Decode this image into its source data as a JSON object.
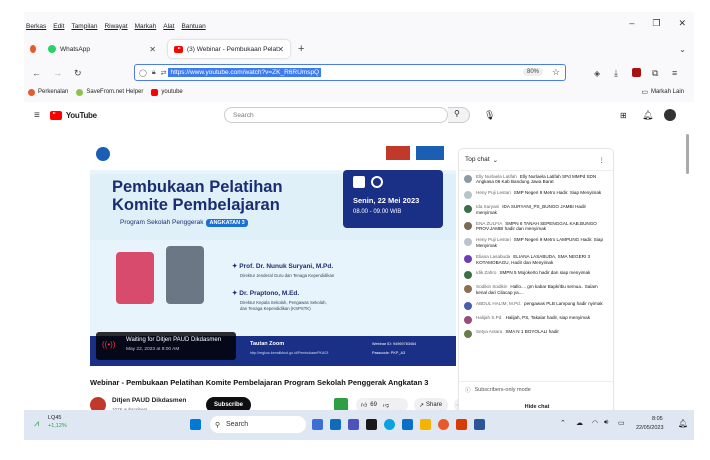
{
  "menubar": {
    "items": [
      "Berkas",
      "Edit",
      "Tampilan",
      "Riwayat",
      "Markah",
      "Alat",
      "Bantuan"
    ]
  },
  "tabs": [
    {
      "label": "WhatsApp",
      "icon": "whatsapp-icon"
    },
    {
      "label": "(3) Webinar - Pembukaan Pelat",
      "icon": "youtube-icon"
    }
  ],
  "navbar": {
    "url": "https://www.youtube.com/watch?v=ZK_R6RUmspQ",
    "zoom": "80%"
  },
  "bookmarks": [
    {
      "label": "Perkenalan"
    },
    {
      "label": "SaveFrom.net Helper"
    },
    {
      "label": "youtube"
    }
  ],
  "bookmarks_other": "Markah Lain",
  "youtube": {
    "logo": "YouTube",
    "search_placeholder": "Search"
  },
  "video": {
    "title_line1": "Pembukaan Pelatihan",
    "title_line2": "Komite Pembelajaran",
    "subtitle": "Program Sekolah Penggerak",
    "badge": "ANGKATAN 3",
    "date": "Senin, 22 Mei 2023",
    "time": "08.00 - 09.00 WIB",
    "speaker1_name": "Prof. Dr. Nunuk Suryani, M.Pd.",
    "speaker1_role": "Direktur Jenderal Guru dan Tenaga Kependidikan",
    "speaker2_name": "Dr. Praptono, M.Ed.",
    "speaker2_role1": "Direktur Kepala Sekolah, Pengawas Sekolah,",
    "speaker2_role2": "dan Tenaga Kependidikan (KSPSTK)",
    "zoom_label": "Tautan Zoom",
    "zoom_link": "http://regkus.kemdikbud.go.id/PembukaanPKA03",
    "webinar_id": "Webinar ID: 94969783464",
    "passcode": "Passcode: PKP_A3",
    "waiting_title": "Waiting for Ditjen PAUD Dikdasmen",
    "waiting_time": "May 22, 2023 at 8:00 AM"
  },
  "page": {
    "video_title": "Webinar - Pembukaan Pelatihan Komite Pembelajaran Program Sekolah Penggerak Angkatan 3",
    "channel": "Ditjen PAUD Dikdasmen",
    "subscribers": "107K subscribers",
    "subscribe": "Subscribe",
    "likes": "69",
    "share": "Share"
  },
  "chat": {
    "header": "Top chat",
    "messages": [
      {
        "author": "Elly Nurlaela Latifah",
        "text": "Elly Nurlaela Latifah SPd MMPd SDN Angkasa 06 Kab Bandung Jawa Barat",
        "color": "#8a9aa6"
      },
      {
        "author": "Heny Puji Lestari",
        "text": "SMP Negeri 9 Metro Hadir. Siap Menyimak",
        "color": "#b9c3ca"
      },
      {
        "author": "Ida Suryani",
        "text": "IDA SURYANI_PS_BUNGO JAMBI Hadir menyimak",
        "color": "#3c6e47"
      },
      {
        "author": "ENA ZULFIA",
        "text": "SMPN 6 TANAH SEPENGGAL KAB.BUNGO PROV.JAMBI hadir dan menyimak",
        "color": "#7b6a52"
      },
      {
        "author": "Heny Puji Lestari",
        "text": "SMP Negeri 9 Metro LAMPUNG Hadir. Siap Menyimak",
        "color": "#b9c3ca"
      },
      {
        "author": "Eliana Lasabuda",
        "text": "ELIANA LASABUDA, SMA NEGERI 3 KOTAMOBAGU, Hadir dan Menyimak",
        "color": "#6a3fb5"
      },
      {
        "author": "Idik Zahro",
        "text": "SMPN 5 Mojokerto hadir dan siap menyimak",
        "color": "#3c6e47"
      },
      {
        "author": "Sodikin Sodikin",
        "text": "Hallo.... gm kabar Bapk/Ibu semua.. Salam kenal dari Cilacap ya....",
        "color": "#8b6f4f"
      },
      {
        "author": "ABDUL HALIM, M.Pd.",
        "text": "pengawas PLB Lampung hadir nyimak",
        "color": "#4b5dae"
      },
      {
        "author": "Halijah S.Pd.",
        "text": "Halijah, PS, Takalar hadir, siap menyimak",
        "color": "#9a4b7d"
      },
      {
        "author": "Setya Antara",
        "text": "SMA N 1 BOYOLALI hadir",
        "color": "#6b7c4a"
      }
    ],
    "subscribers_only": "Subscribers-only mode",
    "hide_chat": "Hide chat"
  },
  "taskbar": {
    "stock_name": "LQ45",
    "stock_change": "+1,12%",
    "search": "Search",
    "time": "8:05",
    "date": "22/05/2023"
  }
}
